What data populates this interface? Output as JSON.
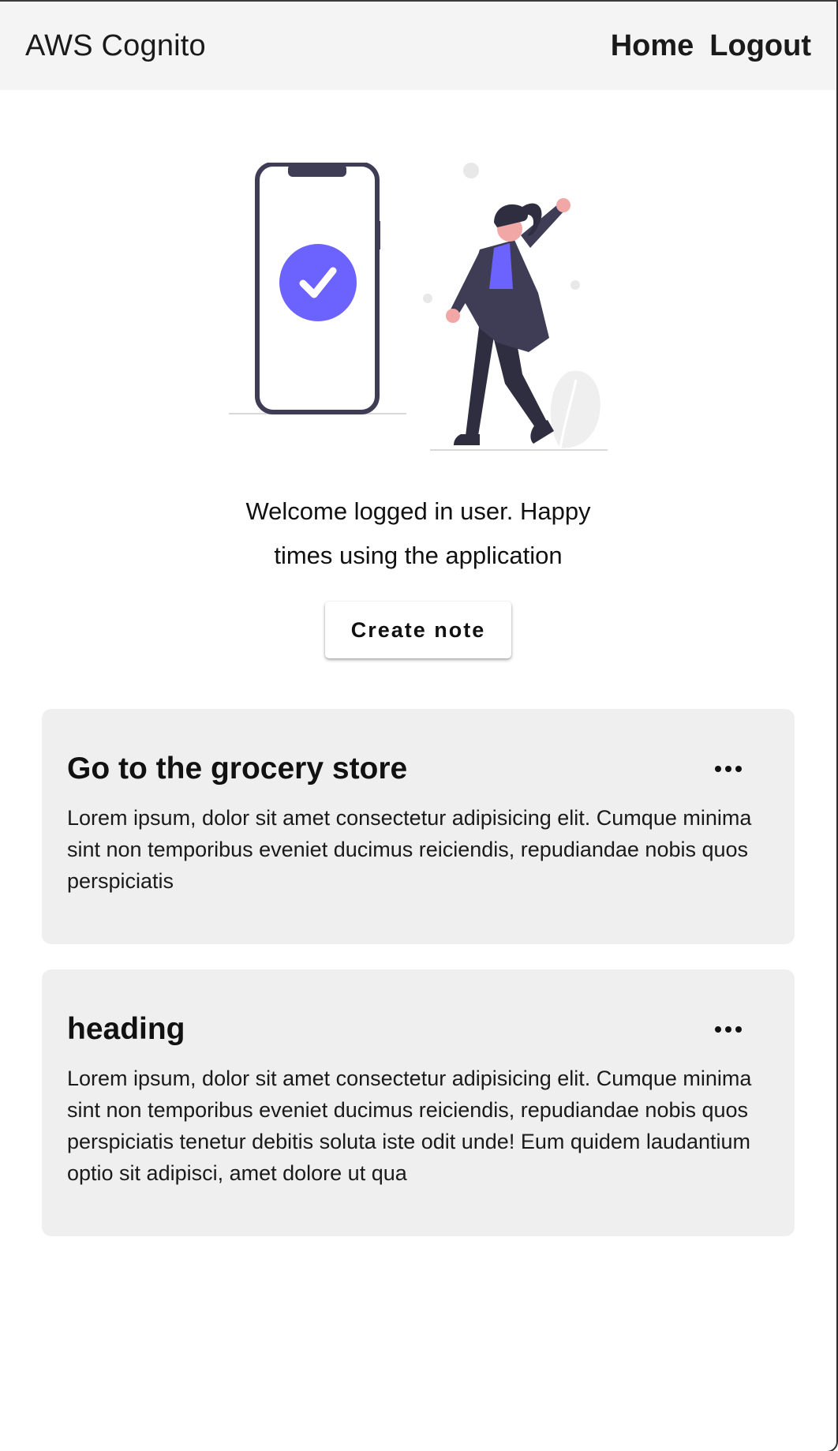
{
  "navbar": {
    "brand": "AWS Cognito",
    "links": [
      {
        "label": "Home"
      },
      {
        "label": "Logout"
      }
    ]
  },
  "hero": {
    "illustration": "phone-checkmark-woman-celebrating",
    "welcome_text": "Welcome logged in user. Happy times using the application"
  },
  "actions": {
    "create_note_label": "Create note"
  },
  "notes": [
    {
      "title": "Go to the grocery store",
      "body": "Lorem ipsum, dolor sit amet consectetur adipisicing elit. Cumque minima sint non temporibus eveniet ducimus reiciendis, repudiandae nobis quos perspiciatis",
      "menu_icon": "more-horizontal-icon"
    },
    {
      "title": "heading",
      "body": "Lorem ipsum, dolor sit amet consectetur adipisicing elit. Cumque minima sint non temporibus eveniet ducimus reiciendis, repudiandae nobis quos perspiciatis tenetur debitis soluta iste odit unde! Eum quidem laudantium optio sit adipisci, amet dolore ut qua",
      "menu_icon": "more-horizontal-icon"
    }
  ],
  "colors": {
    "accent": "#6c63ff",
    "navbar_bg": "#f4f4f4",
    "card_bg": "#efefef",
    "dark": "#3f3d56"
  }
}
